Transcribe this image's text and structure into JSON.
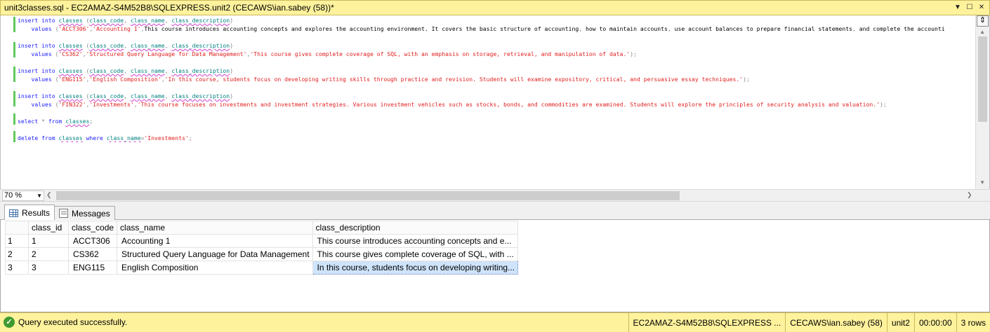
{
  "window": {
    "title": "unit3classes.sql - EC2AMAZ-S4M52B8\\SQLEXPRESS.unit2 (CECAWS\\ian.sabey (58))*"
  },
  "editor": {
    "lines": [
      {
        "kind": "insert",
        "text": "insert into classes (class_code, class_name, class_description)"
      },
      {
        "kind": "values",
        "text": "    values ('ACCT306','Accounting 1','This course introduces accounting concepts and explores the accounting environment. It covers the basic structure of accounting, how to maintain accounts, use account balances to prepare financial statements, and complete the accounti"
      },
      {
        "kind": "blank",
        "text": ""
      },
      {
        "kind": "insert",
        "text": "insert into classes (class_code, class_name, class_description)"
      },
      {
        "kind": "values",
        "text": "    values ('CS362','Structured Query Language for Data Management','This course gives complete coverage of SQL, with an emphasis on storage, retrieval, and manipulation of data.');"
      },
      {
        "kind": "blank",
        "text": ""
      },
      {
        "kind": "insert",
        "text": "insert into classes (class_code, class_name, class_description)"
      },
      {
        "kind": "values",
        "text": "    values ('ENG115','English Composition','In this course, students focus on developing writing skills through practice and revision. Students will examine expository, critical, and persuasive essay techniques.');"
      },
      {
        "kind": "blank",
        "text": ""
      },
      {
        "kind": "insert",
        "text": "insert into classes (class_code, class_name, class_description)"
      },
      {
        "kind": "values",
        "text": "    values ('FIN322','Investments','This course focuses on investments and investment strategies. Various investment vehicles such as stocks, bonds, and commodities are examined. Students will explore the principles of security analysis and valuation.');"
      },
      {
        "kind": "blank",
        "text": ""
      },
      {
        "kind": "select",
        "text": "select * from classes;"
      },
      {
        "kind": "blank",
        "text": ""
      },
      {
        "kind": "delete",
        "text": "delete from classes where class_name='Investments';"
      }
    ]
  },
  "zoom": {
    "value": "70 %"
  },
  "tabs": {
    "results": "Results",
    "messages": "Messages"
  },
  "results": {
    "columns": [
      "",
      "class_id",
      "class_code",
      "class_name",
      "class_description"
    ],
    "rows": [
      [
        "1",
        "1",
        "ACCT306",
        "Accounting 1",
        "This course introduces accounting concepts and e..."
      ],
      [
        "2",
        "2",
        "CS362",
        "Structured Query Language for Data Management",
        "This course gives complete coverage of SQL, with ..."
      ],
      [
        "3",
        "3",
        "ENG115",
        "English Composition",
        "In this course, students focus on developing writing..."
      ]
    ]
  },
  "status": {
    "message": "Query executed successfully.",
    "server": "EC2AMAZ-S4M52B8\\SQLEXPRESS ...",
    "user": "CECAWS\\ian.sabey (58)",
    "database": "unit2",
    "elapsed": "00:00:00",
    "rows": "3 rows"
  },
  "colors": {
    "titlebar": "#fff29d",
    "keyword": "#1c1cff",
    "string": "#e21e1e",
    "object": "#008080",
    "success": "#3f9a2f"
  }
}
